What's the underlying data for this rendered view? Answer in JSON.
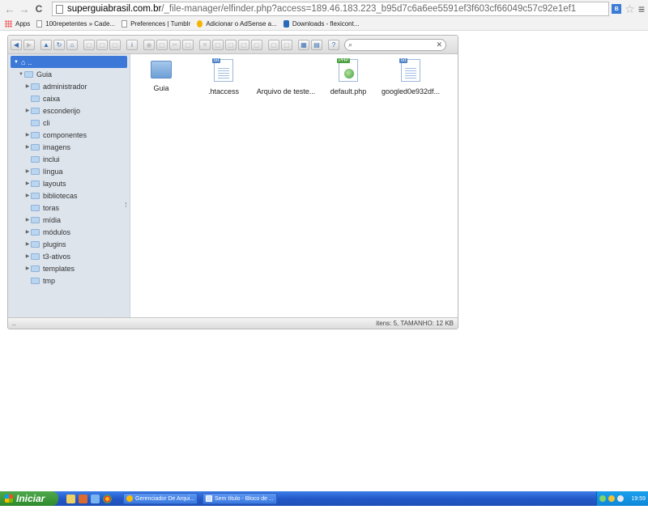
{
  "browser": {
    "url_host": "superguiabrasil.com.br",
    "url_path": "/_file-manager/elfinder.php?access=189.46.183.223_b95d7c6a6ee5591ef3f603cf66049c57c92e1ef1",
    "bookmarks": [
      {
        "label": "Apps",
        "icon": "apps-icon"
      },
      {
        "label": "100repetentes » Cade...",
        "icon": "page-icon"
      },
      {
        "label": "Preferences | Tumblr",
        "icon": "page-icon"
      },
      {
        "label": "Adicionar o AdSense a...",
        "icon": "adsense-icon"
      },
      {
        "label": "Downloads - flexicont...",
        "icon": "download-icon"
      }
    ]
  },
  "elfinder": {
    "search_placeholder": "",
    "tree_root": "..",
    "tree": [
      {
        "label": "Guia",
        "expand": true,
        "level": 0
      },
      {
        "label": "administrador",
        "expand": true,
        "level": 1
      },
      {
        "label": "caixa",
        "expand": false,
        "level": 1
      },
      {
        "label": "esconderijo",
        "expand": true,
        "level": 1
      },
      {
        "label": "cli",
        "expand": false,
        "level": 1
      },
      {
        "label": "componentes",
        "expand": true,
        "level": 1
      },
      {
        "label": "imagens",
        "expand": true,
        "level": 1
      },
      {
        "label": "inclui",
        "expand": false,
        "level": 1
      },
      {
        "label": "língua",
        "expand": true,
        "level": 1
      },
      {
        "label": "layouts",
        "expand": true,
        "level": 1
      },
      {
        "label": "bibliotecas",
        "expand": true,
        "level": 1
      },
      {
        "label": "toras",
        "expand": false,
        "level": 1
      },
      {
        "label": "mídia",
        "expand": true,
        "level": 1
      },
      {
        "label": "módulos",
        "expand": true,
        "level": 1
      },
      {
        "label": "plugins",
        "expand": true,
        "level": 1
      },
      {
        "label": "t3-ativos",
        "expand": true,
        "level": 1
      },
      {
        "label": "templates",
        "expand": true,
        "level": 1
      },
      {
        "label": "tmp",
        "expand": false,
        "level": 1
      }
    ],
    "files": [
      {
        "name": "Guia",
        "type": "folder"
      },
      {
        "name": ".htaccess",
        "type": "txt",
        "tag": "txt"
      },
      {
        "name": "Arquivo de teste...",
        "type": "blank"
      },
      {
        "name": "default.php",
        "type": "php",
        "tag": "PHP"
      },
      {
        "name": "googled0e932df...",
        "type": "txt",
        "tag": "txt"
      }
    ],
    "status_left": "..",
    "status_right": "itens: 5, TAMANHO: 12 KB"
  },
  "taskbar": {
    "start_label": "Iniciar",
    "tasks": [
      {
        "label": "Gerenciador De Arqui...",
        "icon": "chrome-icon"
      },
      {
        "label": "Sem título - Bloco de ...",
        "icon": "notepad-icon"
      }
    ],
    "clock": "19:59"
  }
}
